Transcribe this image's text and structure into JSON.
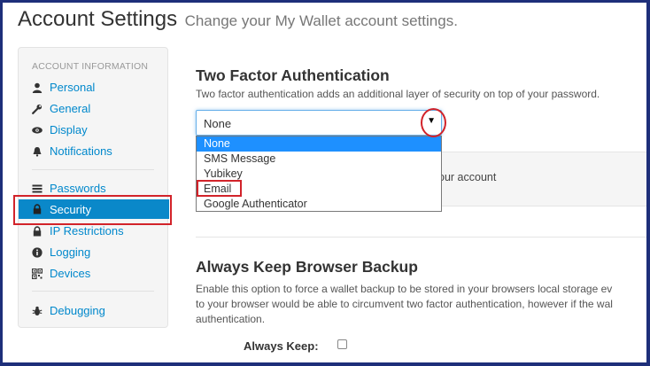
{
  "header": {
    "title": "Account Settings",
    "subtitle": "Change your My Wallet account settings."
  },
  "sidebar": {
    "heading": "ACCOUNT INFORMATION",
    "items": [
      {
        "label": "Personal",
        "icon": "user-icon"
      },
      {
        "label": "General",
        "icon": "wrench-icon"
      },
      {
        "label": "Display",
        "icon": "eye-icon"
      },
      {
        "label": "Notifications",
        "icon": "bell-icon"
      },
      {
        "label": "Passwords",
        "icon": "list-icon"
      },
      {
        "label": "Security",
        "icon": "lock-icon",
        "active": true
      },
      {
        "label": "IP Restrictions",
        "icon": "lock-icon"
      },
      {
        "label": "Logging",
        "icon": "info-icon"
      },
      {
        "label": "Devices",
        "icon": "qrcode-icon"
      },
      {
        "label": "Debugging",
        "icon": "bug-icon"
      }
    ],
    "active_color": "#0a88c9"
  },
  "two_factor": {
    "title": "Two Factor Authentication",
    "description": "Two factor authentication adds an additional layer of security on top of your password.",
    "select_value": "None",
    "options": [
      "None",
      "SMS Message",
      "Yubikey",
      "Email",
      "Google Authenticator"
    ],
    "highlighted_option": "None",
    "panel_text": "our account"
  },
  "backup": {
    "title": "Always Keep Browser Backup",
    "lines": [
      "Enable this option to force a wallet backup to be stored in your browsers local storage ev",
      "to your browser would be able to circumvent two factor authentication, however if the wal",
      "authentication."
    ],
    "checkbox_label": "Always Keep:",
    "checked": false
  },
  "annotation_color": "#d2232a"
}
